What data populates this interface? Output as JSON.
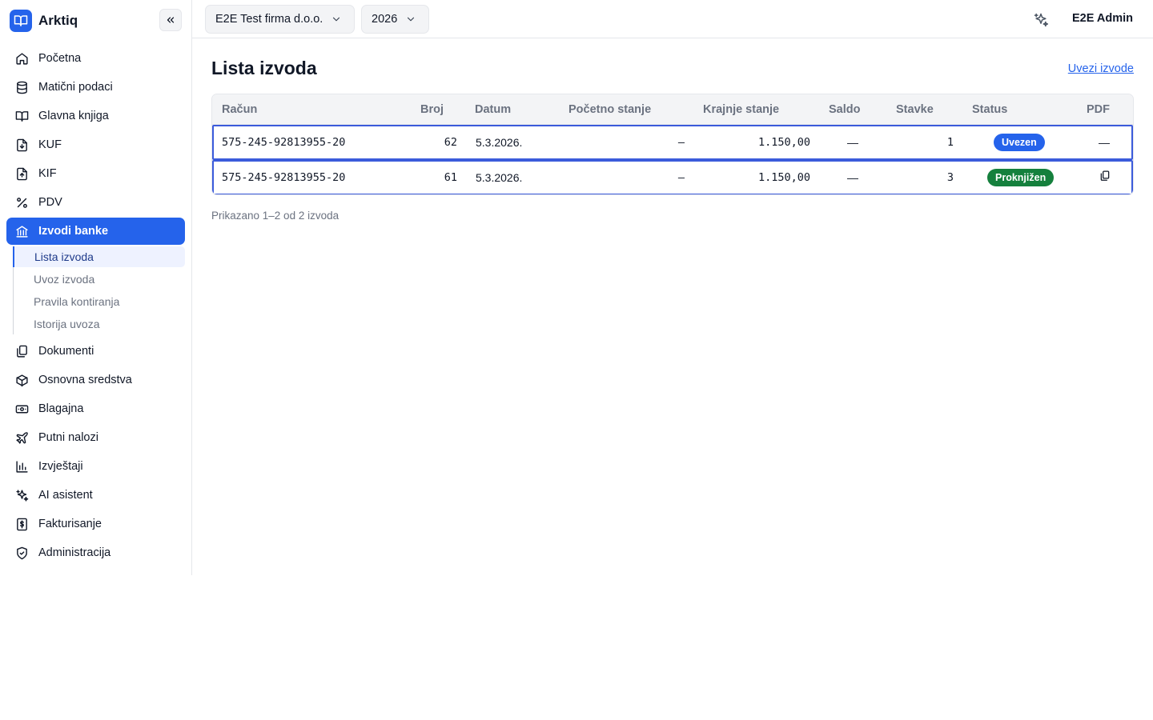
{
  "app": {
    "name": "Arktiq",
    "accent": "#2563eb"
  },
  "topbar": {
    "company": "E2E Test firma d.o.o.",
    "year": "2026",
    "user": "E2E Admin"
  },
  "nav": {
    "items": [
      {
        "label": "Početna",
        "icon": "home-icon"
      },
      {
        "label": "Matični podaci",
        "icon": "database-icon"
      },
      {
        "label": "Glavna knjiga",
        "icon": "book-icon"
      },
      {
        "label": "KUF",
        "icon": "file-in-icon"
      },
      {
        "label": "KIF",
        "icon": "file-out-icon"
      },
      {
        "label": "PDV",
        "icon": "percent-icon"
      },
      {
        "label": "Izvodi banke",
        "icon": "bank-icon",
        "active": true
      },
      {
        "label": "Dokumenti",
        "icon": "documents-icon"
      },
      {
        "label": "Osnovna sredstva",
        "icon": "box-icon"
      },
      {
        "label": "Blagajna",
        "icon": "cash-icon"
      },
      {
        "label": "Putni nalozi",
        "icon": "plane-icon"
      },
      {
        "label": "Izvještaji",
        "icon": "bar-chart-icon"
      },
      {
        "label": "AI asistent",
        "icon": "sparkle-icon"
      },
      {
        "label": "Fakturisanje",
        "icon": "invoice-icon"
      },
      {
        "label": "Administracija",
        "icon": "shield-icon"
      }
    ],
    "subitems": [
      {
        "label": "Lista izvoda",
        "active": true
      },
      {
        "label": "Uvoz izvoda"
      },
      {
        "label": "Pravila kontiranja"
      },
      {
        "label": "Istorija uvoza"
      }
    ]
  },
  "main": {
    "title": "Lista izvoda",
    "action_link": "Uvezi izvode",
    "columns": [
      "Račun",
      "Broj",
      "Datum",
      "Početno stanje",
      "Krajnje stanje",
      "Saldo",
      "Stavke",
      "Status",
      "PDF"
    ],
    "rows": [
      {
        "racun": "575-245-92813955-20",
        "broj": "62",
        "datum": "5.3.2026.",
        "pocetno": "—",
        "krajnje": "1.150,00",
        "saldo": "—",
        "stavke": "1",
        "status": "Uvezen",
        "status_color": "#2563eb",
        "pdf": "—"
      },
      {
        "racun": "575-245-92813955-20",
        "broj": "61",
        "datum": "5.3.2026.",
        "pocetno": "—",
        "krajnje": "1.150,00",
        "saldo": "—",
        "stavke": "3",
        "status": "Proknjižen",
        "status_color": "#15803d",
        "pdf_icon": "copy-icon"
      }
    ],
    "footer": "Prikazano 1–2 od 2 izvoda"
  }
}
